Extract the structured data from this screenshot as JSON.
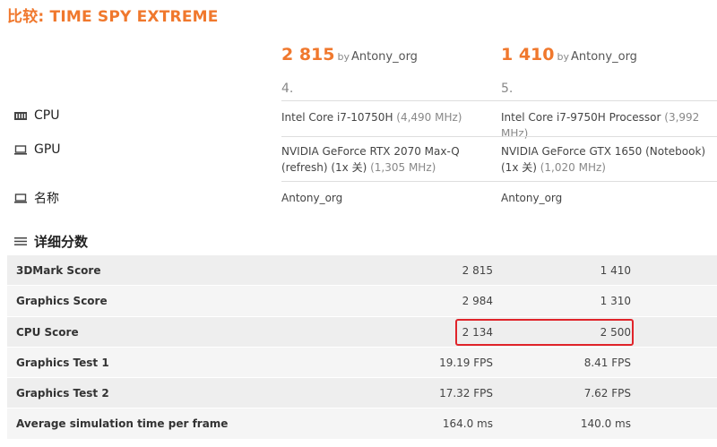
{
  "title": "比较: TIME SPY EXTREME",
  "results": [
    {
      "score": "2 815",
      "by": "by",
      "user": "Antony_org",
      "rank": "4."
    },
    {
      "score": "1 410",
      "by": "by",
      "user": "Antony_org",
      "rank": "5."
    }
  ],
  "specs": {
    "cpu": {
      "label": "CPU",
      "v1_main": "Intel Core i7-10750H",
      "v1_sub": " (4,490 MHz)",
      "v2_main": "Intel Core i7-9750H Processor",
      "v2_sub": " (3,992 MHz)"
    },
    "gpu": {
      "label": "GPU",
      "v1_main": "NVIDIA GeForce RTX 2070 Max-Q (refresh) (1x 关)",
      "v1_sub": " (1,305 MHz)",
      "v2_main": "NVIDIA GeForce GTX 1650 (Notebook) (1x 关)",
      "v2_sub": " (1,020 MHz)"
    },
    "name": {
      "label": "名称",
      "v1": "Antony_org",
      "v2": "Antony_org"
    }
  },
  "detail_title": "详细分数",
  "rows": [
    {
      "label": "3DMark Score",
      "v1": "2 815",
      "v2": "1 410"
    },
    {
      "label": "Graphics Score",
      "v1": "2 984",
      "v2": "1 310"
    },
    {
      "label": "CPU Score",
      "v1": "2 134",
      "v2": "2 500"
    },
    {
      "label": "Graphics Test 1",
      "v1": "19.19 FPS",
      "v2": "8.41 FPS"
    },
    {
      "label": "Graphics Test 2",
      "v1": "17.32 FPS",
      "v2": "7.62 FPS"
    },
    {
      "label": "Average simulation time per frame",
      "v1": "164.0 ms",
      "v2": "140.0 ms"
    }
  ],
  "colors": {
    "accent": "#f0782d",
    "highlight": "#e0242a"
  }
}
